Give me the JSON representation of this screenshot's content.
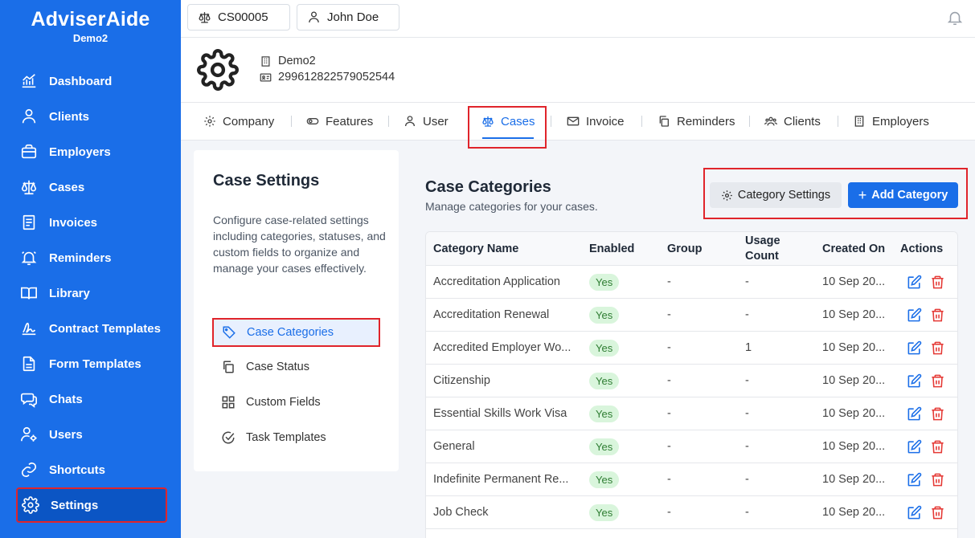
{
  "app": {
    "name": "AdviserAide",
    "workspace": "Demo2"
  },
  "colors": {
    "brand": "#1a6ee8",
    "sidebar_active": "#0b55c4",
    "highlight": "#e0242b",
    "success_bg": "#d9f5dc",
    "success_text": "#2e7d32",
    "danger": "#e53935"
  },
  "sidebar": {
    "items": [
      {
        "label": "Dashboard",
        "icon": "chart-line-icon"
      },
      {
        "label": "Clients",
        "icon": "person-icon"
      },
      {
        "label": "Employers",
        "icon": "briefcase-icon"
      },
      {
        "label": "Cases",
        "icon": "scale-icon"
      },
      {
        "label": "Invoices",
        "icon": "document-lines-icon"
      },
      {
        "label": "Reminders",
        "icon": "bell-icon"
      },
      {
        "label": "Library",
        "icon": "book-icon"
      },
      {
        "label": "Contract Templates",
        "icon": "signature-icon"
      },
      {
        "label": "Form Templates",
        "icon": "file-icon"
      },
      {
        "label": "Chats",
        "icon": "chat-icon"
      },
      {
        "label": "Users",
        "icon": "user-gear-icon"
      },
      {
        "label": "Shortcuts",
        "icon": "link-icon"
      },
      {
        "label": "Settings",
        "icon": "gear-icon",
        "active": true
      }
    ]
  },
  "topbar": {
    "case_id": "CS00005",
    "user_name": "John Doe"
  },
  "company": {
    "name": "Demo2",
    "id_number": "299612822579052544"
  },
  "tabs": [
    {
      "label": "Company",
      "icon": "gear-icon"
    },
    {
      "label": "Features",
      "icon": "toggle-icon"
    },
    {
      "label": "User",
      "icon": "person-icon"
    },
    {
      "label": "Cases",
      "icon": "scale-icon",
      "active": true
    },
    {
      "label": "Invoice",
      "icon": "mail-icon"
    },
    {
      "label": "Reminders",
      "icon": "copy-icon"
    },
    {
      "label": "Clients",
      "icon": "users-icon"
    },
    {
      "label": "Employers",
      "icon": "building-icon"
    }
  ],
  "case_settings": {
    "title": "Case Settings",
    "description": "Configure case-related settings including categories, statuses, and custom fields to organize and manage your cases effectively.",
    "links": [
      {
        "label": "Case Categories",
        "icon": "tag-icon",
        "active": true
      },
      {
        "label": "Case Status",
        "icon": "copy-icon"
      },
      {
        "label": "Custom Fields",
        "icon": "grid-icon"
      },
      {
        "label": "Task Templates",
        "icon": "check-circle-icon"
      }
    ]
  },
  "categories": {
    "title": "Case Categories",
    "subtitle": "Manage categories for your cases.",
    "settings_button": "Category Settings",
    "add_button": "Add Category",
    "add_symbol": "+",
    "columns": [
      "Category Name",
      "Enabled",
      "Group",
      "Usage Count",
      "Created On",
      "Actions"
    ],
    "rows": [
      {
        "name": "Accreditation Application",
        "enabled": "Yes",
        "group": "-",
        "usage": "-",
        "created": "10 Sep 20..."
      },
      {
        "name": "Accreditation Renewal",
        "enabled": "Yes",
        "group": "-",
        "usage": "-",
        "created": "10 Sep 20..."
      },
      {
        "name": "Accredited Employer Wo...",
        "enabled": "Yes",
        "group": "-",
        "usage": "1",
        "created": "10 Sep 20..."
      },
      {
        "name": "Citizenship",
        "enabled": "Yes",
        "group": "-",
        "usage": "-",
        "created": "10 Sep 20..."
      },
      {
        "name": "Essential Skills Work Visa",
        "enabled": "Yes",
        "group": "-",
        "usage": "-",
        "created": "10 Sep 20..."
      },
      {
        "name": "General",
        "enabled": "Yes",
        "group": "-",
        "usage": "-",
        "created": "10 Sep 20..."
      },
      {
        "name": "Indefinite Permanent Re...",
        "enabled": "Yes",
        "group": "-",
        "usage": "-",
        "created": "10 Sep 20..."
      },
      {
        "name": "Job Check",
        "enabled": "Yes",
        "group": "-",
        "usage": "-",
        "created": "10 Sep 20..."
      }
    ]
  }
}
